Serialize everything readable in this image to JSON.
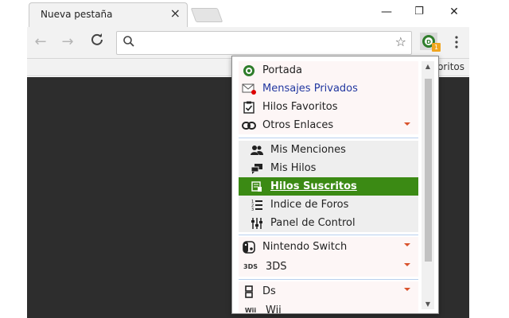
{
  "browser": {
    "tab_title": "Nueva pestaña",
    "tab_close": "×",
    "window_minimize": "—",
    "window_restore": "❐",
    "window_close": "✕",
    "bookmarks_partial": "oritos",
    "extension_badge": "1"
  },
  "popup": {
    "items": [
      {
        "label": "Portada",
        "icon": "home-logo-icon"
      },
      {
        "label": "Mensajes Privados",
        "icon": "envelope-icon"
      },
      {
        "label": "Hilos Favoritos",
        "icon": "clipboard-check-icon"
      },
      {
        "label": "Otros Enlaces",
        "icon": "link-icon"
      }
    ],
    "sub_items": [
      {
        "label": "Mis Menciones",
        "icon": "users-icon"
      },
      {
        "label": "Mis Hilos",
        "icon": "chat-bubbles-icon"
      },
      {
        "label": "Hilos Suscritos",
        "icon": "bookmark-stack-icon"
      },
      {
        "label": "Indice de Foros",
        "icon": "numbered-list-icon"
      },
      {
        "label": "Panel de Control",
        "icon": "sliders-icon"
      }
    ],
    "platforms": [
      {
        "label": "Nintendo Switch",
        "icon": "switch-icon"
      },
      {
        "label": "3DS",
        "icon": "3ds-logo-icon",
        "icon_text": "3DS"
      },
      {
        "label": "Ds",
        "icon": "ds-icon"
      },
      {
        "label": "Wii",
        "icon": "wii-logo-icon",
        "icon_text": "Wii"
      }
    ]
  },
  "colors": {
    "active_row": "#3b8a14",
    "caret": "#d9532c",
    "separator": "#b8d0ee",
    "page_background": "#2d2d2d"
  }
}
